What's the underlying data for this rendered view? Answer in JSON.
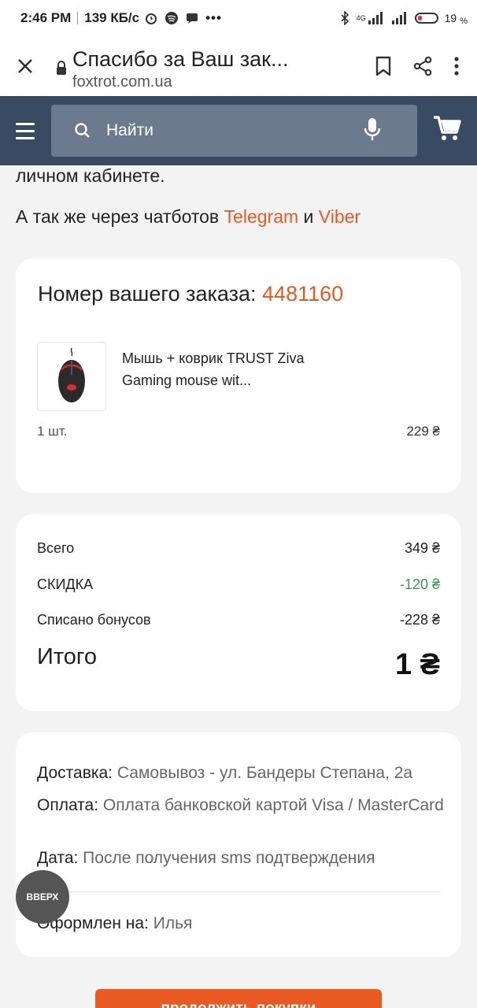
{
  "status_bar": {
    "time": "2:46 PM",
    "speed": "139 КБ/с",
    "network": "4G",
    "battery": "19",
    "battery_unit": "%"
  },
  "browser": {
    "title": "Спасибо за Ваш зак...",
    "url": "foxtrot.com.ua"
  },
  "header": {
    "search_placeholder": "Найти"
  },
  "intro": {
    "line1": "личном кабинете.",
    "line2_prefix": "А так же через чатботов ",
    "telegram": "Telegram",
    "and": " и ",
    "viber": "Viber"
  },
  "order": {
    "label": "Номер вашего заказа: ",
    "number": "4481160",
    "product_name": "Мышь + коврик TRUST Ziva Gaming mouse wit...",
    "qty": "1 шт.",
    "price": "229 ₴"
  },
  "summary": {
    "total_label": "Всего",
    "total_value": "349 ₴",
    "discount_label": "СКИДКА",
    "discount_value": "-120 ₴",
    "bonus_label": "Списано бонусов",
    "bonus_value": "-228 ₴",
    "grand_label": "Итого",
    "grand_value": "1 ₴"
  },
  "details": {
    "delivery_label": "Доставка:",
    "delivery_value": " Самовывоз - ул. Бандеры Степана, 2а",
    "payment_label": "Оплата:",
    "payment_value": " Оплата банковской картой Visa / MasterCard",
    "date_label": "Дата:",
    "date_value": " После получения sms подтверждения",
    "owner_label": "Оформлен на:",
    "owner_value": " Илья"
  },
  "buttons": {
    "up": "ВВЕРХ",
    "continue": "продолжить покупки"
  },
  "colors": {
    "accent": "#e85a22",
    "header_bg": "#394b63",
    "discount": "#2e9e4f"
  }
}
